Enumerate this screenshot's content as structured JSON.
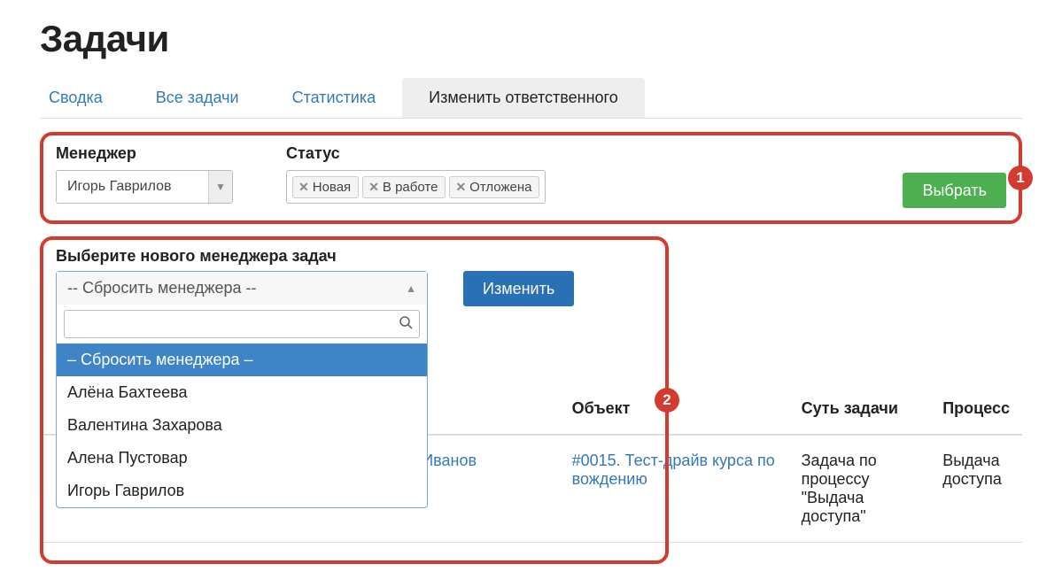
{
  "page_title": "Задачи",
  "tabs": {
    "summary": "Сводка",
    "all": "Все задачи",
    "stats": "Статистика",
    "change_resp": "Изменить ответственного"
  },
  "filter": {
    "manager_label": "Менеджер",
    "manager_value": "Игорь Гаврилов",
    "status_label": "Статус",
    "status_tags": {
      "t0": "Новая",
      "t1": "В работе",
      "t2": "Отложена"
    },
    "select_btn": "Выбрать"
  },
  "reassign": {
    "label": "Выберите нового менеджера задач",
    "dropdown_current": "-- Сбросить менеджера --",
    "search_placeholder": "",
    "options": {
      "o0": "– Сбросить менеджера –",
      "o1": "Алёна Бахтеева",
      "o2": "Валентина Захарова",
      "o3": "Алена Пустовар",
      "o4": "Игорь Гаврилов"
    },
    "change_btn": "Изменить"
  },
  "annotations": {
    "a1": "1",
    "a2": "2"
  },
  "table": {
    "headers": {
      "obj": "Объект",
      "essence": "Суть задачи",
      "process": "Процесс"
    },
    "rows": {
      "r0": {
        "client_fragment": "Иванов",
        "object": "#0015. Тест-драйв курса по вождению",
        "essence": "Задача по процессу \"Выдача доступа\"",
        "process": "Выдача доступа"
      }
    }
  }
}
